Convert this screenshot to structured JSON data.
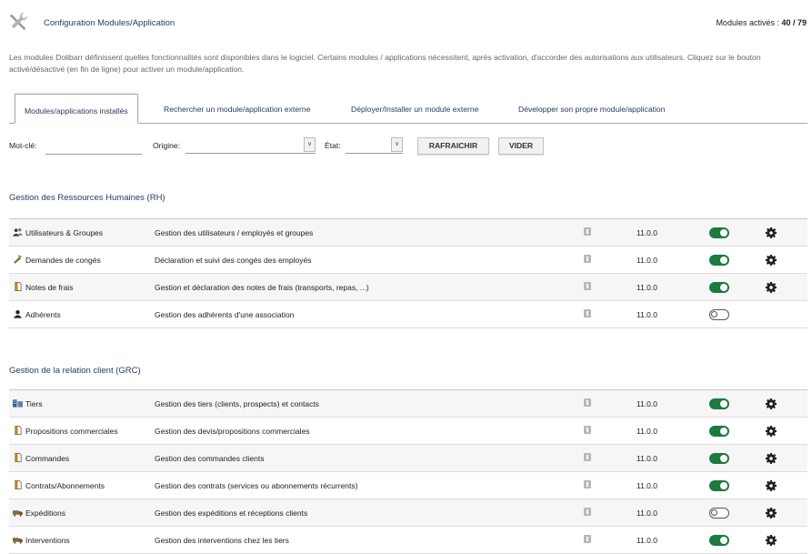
{
  "header": {
    "title": "Configuration Modules/Application",
    "modules_active_label": "Modules activés : ",
    "modules_active_count": "40 / 79"
  },
  "description": "Les modules Dolibarr définissent quelles fonctionnalités sont disponibles dans le logiciel. Certains modules / applications nécessitent, après activation, d'accorder des autorisations aux utilisateurs. Cliquez sur le bouton activé/désactivé (en fin de ligne) pour activer un module/application.",
  "tabs": [
    {
      "label": "Modules/applications installés",
      "active": true
    },
    {
      "label": "Rechercher un module/application externe",
      "active": false
    },
    {
      "label": "Déployer/Installer un module externe",
      "active": false
    },
    {
      "label": "Développer son propre module/application",
      "active": false
    }
  ],
  "filters": {
    "keyword_label": "Mot-clé:",
    "keyword_value": "",
    "origin_label": "Origine:",
    "origin_value": "",
    "state_label": "État:",
    "state_value": "",
    "refresh_label": "RAFRAICHIR",
    "clear_label": "VIDER"
  },
  "colors": {
    "accent": "#263c5c",
    "toggle_on": "#1c7a3f",
    "row_alt": "#f6f6f6"
  },
  "sections": [
    {
      "title": "Gestion des Ressources Humaines (RH)",
      "modules": [
        {
          "name": "Utilisateurs & Groupes",
          "icon": "users-icon",
          "description": "Gestion des utilisateurs / employés et groupes",
          "version": "11.0.0",
          "enabled": true,
          "has_config": true
        },
        {
          "name": "Demandes de congés",
          "icon": "holiday-icon",
          "description": "Déclaration et suivi des congés des employés",
          "version": "11.0.0",
          "enabled": true,
          "has_config": true
        },
        {
          "name": "Notes de frais",
          "icon": "document-icon",
          "description": "Gestion et déclaration des notes de frais (transports, repas, ...)",
          "version": "11.0.0",
          "enabled": true,
          "has_config": true
        },
        {
          "name": "Adhérents",
          "icon": "member-icon",
          "description": "Gestion des adhérents d'une association",
          "version": "11.0.0",
          "enabled": false,
          "has_config": false
        }
      ]
    },
    {
      "title": "Gestion de la relation client (GRC)",
      "modules": [
        {
          "name": "Tiers",
          "icon": "company-icon",
          "description": "Gestion des tiers (clients, prospects) et contacts",
          "version": "11.0.0",
          "enabled": true,
          "has_config": true
        },
        {
          "name": "Propositions commerciales",
          "icon": "document-icon",
          "description": "Gestion des devis/propositions commerciales",
          "version": "11.0.0",
          "enabled": true,
          "has_config": true
        },
        {
          "name": "Commandes",
          "icon": "document-icon",
          "description": "Gestion des commandes clients",
          "version": "11.0.0",
          "enabled": true,
          "has_config": true
        },
        {
          "name": "Contrats/Abonnements",
          "icon": "document-icon",
          "description": "Gestion des contrats (services ou abonnements récurrents)",
          "version": "11.0.0",
          "enabled": true,
          "has_config": true
        },
        {
          "name": "Expéditions",
          "icon": "shipping-icon",
          "description": "Gestion des expéditions et réceptions clients",
          "version": "11.0.0",
          "enabled": false,
          "has_config": true
        },
        {
          "name": "Interventions",
          "icon": "shipping-icon",
          "description": "Gestion des interventions chez les tiers",
          "version": "11.0.0",
          "enabled": true,
          "has_config": true
        }
      ]
    }
  ]
}
